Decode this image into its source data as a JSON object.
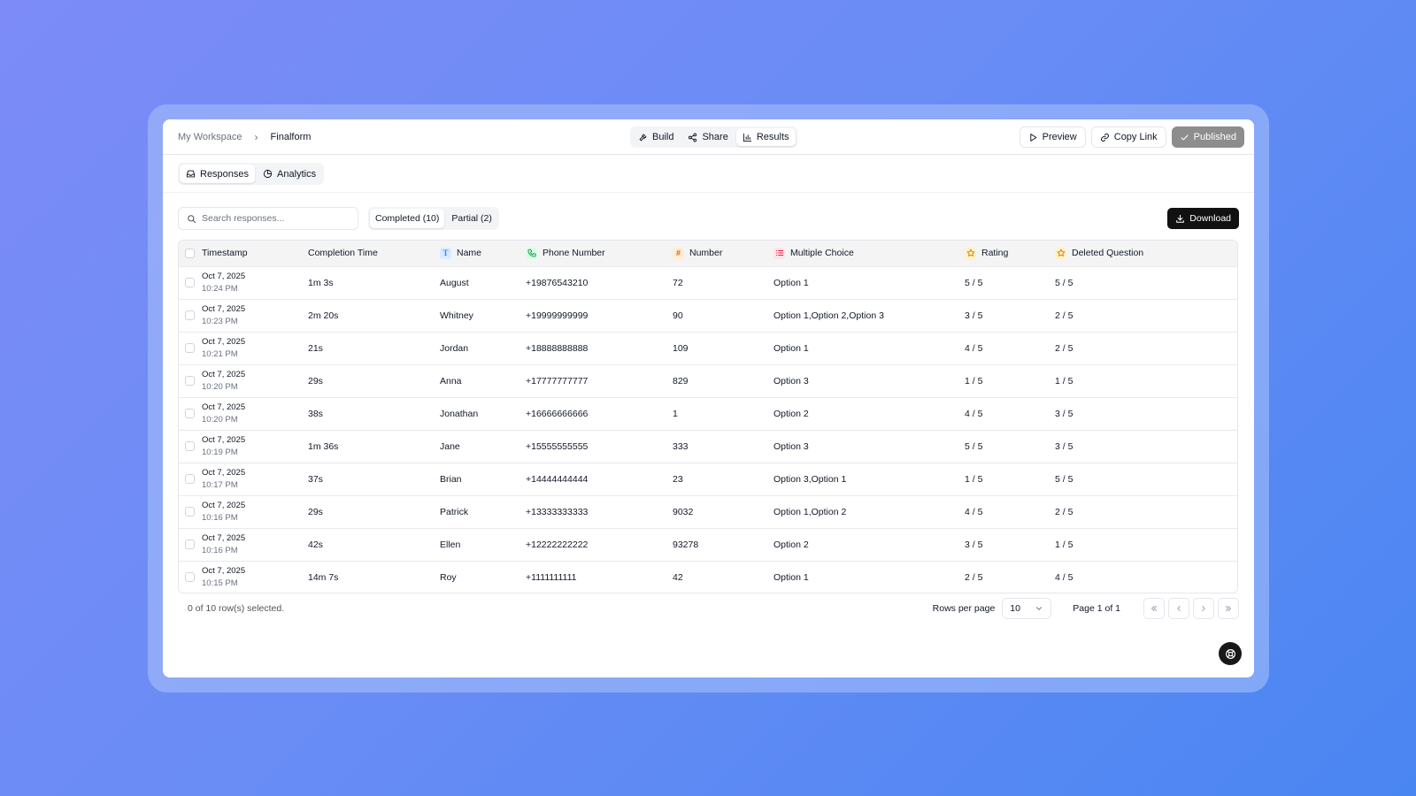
{
  "breadcrumb": {
    "root": "My Workspace",
    "separator": "›",
    "current": "Finalform"
  },
  "center_tabs": [
    {
      "label": "Build",
      "icon": "hammer-icon"
    },
    {
      "label": "Share",
      "icon": "share-icon"
    },
    {
      "label": "Results",
      "icon": "bar-chart-icon",
      "active": true
    }
  ],
  "actions": {
    "preview": "Preview",
    "copy_link": "Copy Link",
    "published": "Published"
  },
  "sub_tabs": [
    {
      "label": "Responses",
      "icon": "inbox-icon",
      "active": true
    },
    {
      "label": "Analytics",
      "icon": "pie-chart-icon"
    }
  ],
  "search": {
    "placeholder": "Search responses..."
  },
  "filters": {
    "completed": "Completed (10)",
    "partial": "Partial (2)"
  },
  "download_label": "Download",
  "columns": [
    {
      "label": "Timestamp"
    },
    {
      "label": "Completion Time"
    },
    {
      "label": "Name",
      "icon": "T",
      "color": "#3b82f6",
      "bg": "#dbeafe"
    },
    {
      "label": "Phone Number",
      "icon": "phone",
      "color": "#16a34a",
      "bg": "#dcfce7"
    },
    {
      "label": "Number",
      "icon": "#",
      "color": "#ea580c",
      "bg": "#ffedd5"
    },
    {
      "label": "Multiple Choice",
      "icon": "list",
      "color": "#e11d48",
      "bg": "#ffe4e6"
    },
    {
      "label": "Rating",
      "icon": "star",
      "color": "#d97706",
      "bg": "#fef3c7"
    },
    {
      "label": "Deleted Question",
      "icon": "star",
      "color": "#d97706",
      "bg": "#fef3c7"
    }
  ],
  "rows": [
    {
      "date": "Oct 7, 2025",
      "time": "10:24 PM",
      "completion": "1m 3s",
      "name": "August",
      "phone": "+19876543210",
      "number": "72",
      "choice": "Option 1",
      "rating": "5 / 5",
      "deleted": "5 / 5"
    },
    {
      "date": "Oct 7, 2025",
      "time": "10:23 PM",
      "completion": "2m 20s",
      "name": "Whitney",
      "phone": "+19999999999",
      "number": "90",
      "choice": "Option 1,Option 2,Option 3",
      "rating": "3 / 5",
      "deleted": "2 / 5"
    },
    {
      "date": "Oct 7, 2025",
      "time": "10:21 PM",
      "completion": "21s",
      "name": "Jordan",
      "phone": "+18888888888",
      "number": "109",
      "choice": "Option 1",
      "rating": "4 / 5",
      "deleted": "2 / 5"
    },
    {
      "date": "Oct 7, 2025",
      "time": "10:20 PM",
      "completion": "29s",
      "name": "Anna",
      "phone": "+17777777777",
      "number": "829",
      "choice": "Option 3",
      "rating": "1 / 5",
      "deleted": "1 / 5"
    },
    {
      "date": "Oct 7, 2025",
      "time": "10:20 PM",
      "completion": "38s",
      "name": "Jonathan",
      "phone": "+16666666666",
      "number": "1",
      "choice": "Option 2",
      "rating": "4 / 5",
      "deleted": "3 / 5"
    },
    {
      "date": "Oct 7, 2025",
      "time": "10:19 PM",
      "completion": "1m 36s",
      "name": "Jane",
      "phone": "+15555555555",
      "number": "333",
      "choice": "Option 3",
      "rating": "5 / 5",
      "deleted": "3 / 5"
    },
    {
      "date": "Oct 7, 2025",
      "time": "10:17 PM",
      "completion": "37s",
      "name": "Brian",
      "phone": "+14444444444",
      "number": "23",
      "choice": "Option 3,Option 1",
      "rating": "1 / 5",
      "deleted": "5 / 5"
    },
    {
      "date": "Oct 7, 2025",
      "time": "10:16 PM",
      "completion": "29s",
      "name": "Patrick",
      "phone": "+13333333333",
      "number": "9032",
      "choice": "Option 1,Option 2",
      "rating": "4 / 5",
      "deleted": "2 / 5"
    },
    {
      "date": "Oct 7, 2025",
      "time": "10:16 PM",
      "completion": "42s",
      "name": "Ellen",
      "phone": "+12222222222",
      "number": "93278",
      "choice": "Option 2",
      "rating": "3 / 5",
      "deleted": "1 / 5"
    },
    {
      "date": "Oct 7, 2025",
      "time": "10:15 PM",
      "completion": "14m 7s",
      "name": "Roy",
      "phone": "+1111111111",
      "number": "42",
      "choice": "Option 1",
      "rating": "2 / 5",
      "deleted": "4 / 5"
    }
  ],
  "footer": {
    "selected": "0 of 10 row(s) selected.",
    "rows_per_page_label": "Rows per page",
    "rows_per_page_value": "10",
    "page_label": "Page 1 of 1"
  }
}
